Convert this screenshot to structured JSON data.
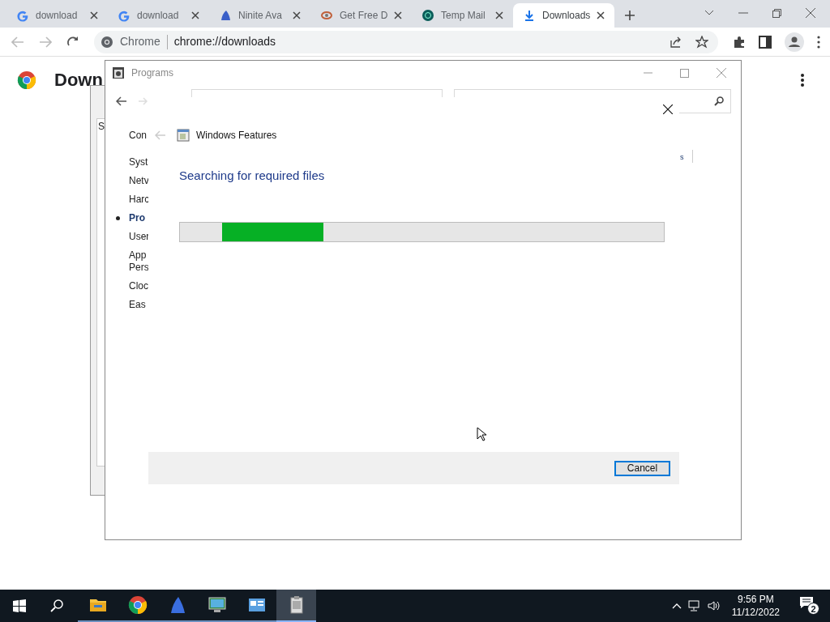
{
  "browser": {
    "tabs": [
      {
        "title": "download",
        "selected": false,
        "kind": "google"
      },
      {
        "title": "download",
        "selected": false,
        "kind": "google"
      },
      {
        "title": "Ninite Ava",
        "selected": false,
        "kind": "ninite"
      },
      {
        "title": "Get Free D",
        "selected": false,
        "kind": "eye"
      },
      {
        "title": "Temp Mail",
        "selected": false,
        "kind": "mail"
      },
      {
        "title": "Downloads",
        "selected": true,
        "kind": "download"
      }
    ],
    "address": {
      "site": "Chrome",
      "url": "chrome://downloads"
    },
    "page_title": "Down"
  },
  "back_window": {
    "fragment": "S"
  },
  "programs_window": {
    "title": "Programs",
    "sidebar": [
      {
        "label": "Con",
        "selected": false
      },
      {
        "label": "Syst",
        "selected": false
      },
      {
        "label": "Netv",
        "selected": false
      },
      {
        "label": "Harc",
        "selected": false
      },
      {
        "label": "Pro",
        "selected": true
      },
      {
        "label": "User",
        "selected": false
      },
      {
        "label": "App\nPers",
        "selected": false
      },
      {
        "label": "Cloc",
        "selected": false
      },
      {
        "label": "Eas",
        "selected": false
      }
    ],
    "fragment": "s"
  },
  "dialog": {
    "title": "Windows Features",
    "heading": "Searching for required files",
    "progress": {
      "level": 0.21
    },
    "buttons": [
      "Cancel"
    ]
  },
  "taskbar": {
    "apps": [
      {
        "kind": "folder",
        "selected": false
      },
      {
        "kind": "chrome",
        "selected": false
      },
      {
        "kind": "ninite",
        "selected": false
      },
      {
        "kind": "monitor",
        "selected": false
      },
      {
        "kind": "panel",
        "selected": false
      },
      {
        "kind": "installer",
        "selected": true
      }
    ],
    "time": "9:56 PM",
    "date": "11/12/2022",
    "notifications": "2"
  }
}
